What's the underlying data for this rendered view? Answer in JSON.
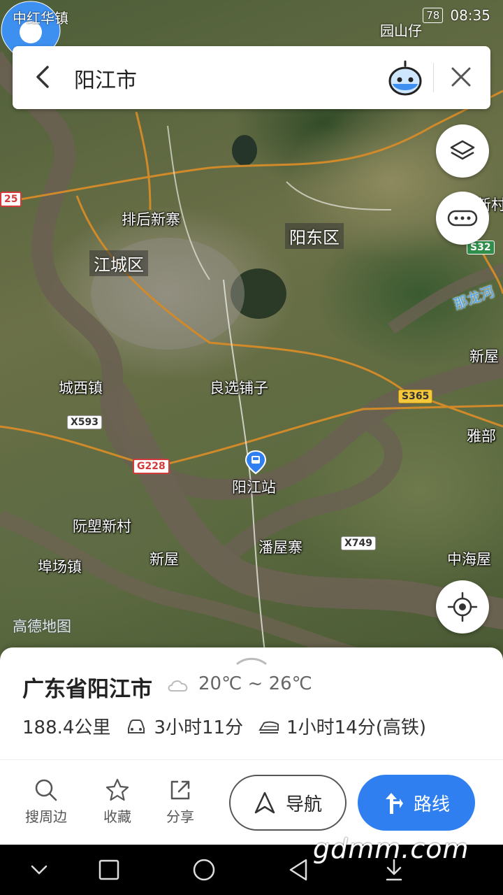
{
  "status_bar": {
    "left_text": "中红华镇",
    "battery": "78",
    "time": "08:35",
    "top_place": "园山仔"
  },
  "search": {
    "query": "阳江市"
  },
  "map": {
    "districts": {
      "jiangcheng": "江城区",
      "yangdong": "阳东区"
    },
    "places": {
      "paihou": "排后新寨",
      "chengxi": "城西镇",
      "liangxuan": "良选铺子",
      "station": "阳江站",
      "ruansu": "阮塱新村",
      "fuchang": "埠场镇",
      "xinwu_left": "新屋",
      "panwuzhai": "潘屋寨",
      "zhonghaiwu": "中海屋",
      "xinwu_right": "新屋",
      "yabu": "雅部",
      "xincun": "新村"
    },
    "roads": {
      "s365": "S365",
      "x593": "X593",
      "g228": "G228",
      "x749": "X749",
      "s32": "S32",
      "r25": "25"
    },
    "river": "那龙河",
    "provider_watermark": "高德地图"
  },
  "sheet": {
    "title": "广东省阳江市",
    "weather": "20℃ ~ 26℃",
    "distance": "188.4公里",
    "drive_time": "3小时11分",
    "train_time": "1小时14分(高铁)"
  },
  "actions": {
    "nearby": "搜周边",
    "favorite": "收藏",
    "share": "分享",
    "navigate": "导航",
    "route": "路线"
  },
  "overlay_watermark": "gdmm.com",
  "colors": {
    "accent": "#2f7ff0",
    "marker": "#3d8ff0"
  }
}
